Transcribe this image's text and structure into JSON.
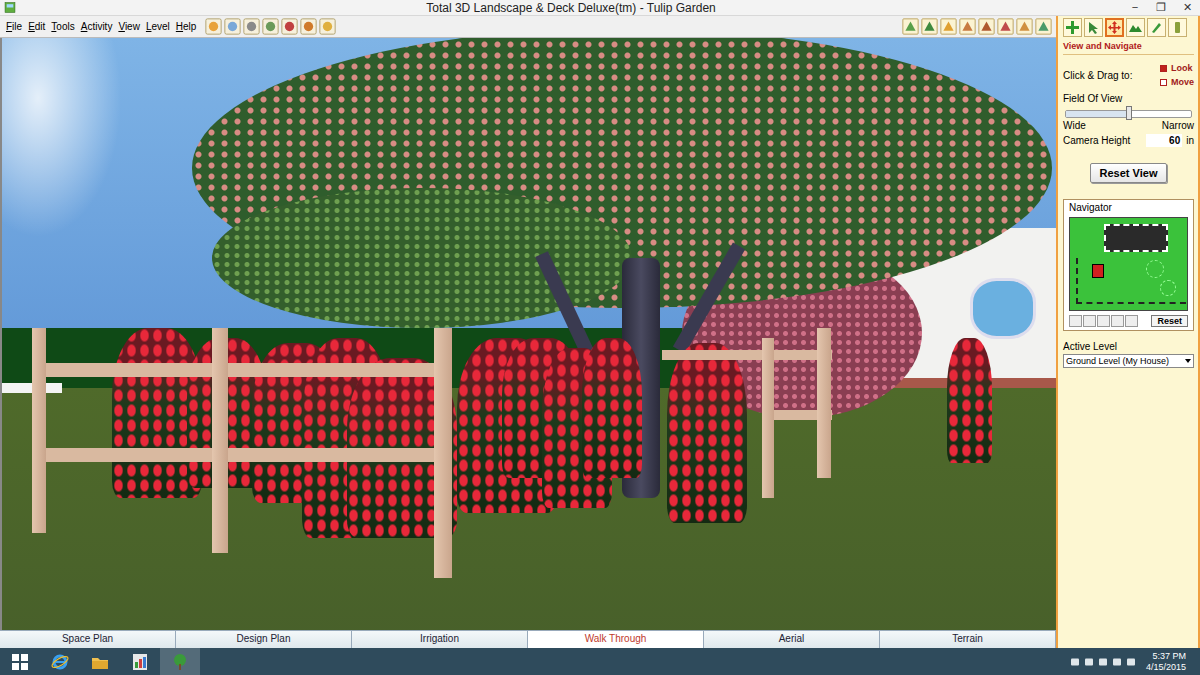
{
  "window": {
    "title": "Total 3D Landscape & Deck Deluxe(tm) - Tulip Garden",
    "controls": [
      "−",
      "❐",
      "✕"
    ]
  },
  "menu": [
    "File",
    "Edit",
    "Tools",
    "Activity",
    "View",
    "Level",
    "Help"
  ],
  "tool_palette": [
    {
      "selected": false
    },
    {
      "selected": false
    },
    {
      "selected": true
    },
    {
      "selected": false
    },
    {
      "selected": false
    },
    {
      "selected": false
    }
  ],
  "panel": {
    "title": "View and Navigate",
    "drag_label": "Click & Drag to:",
    "drag_options": [
      {
        "label": "Look",
        "selected": true
      },
      {
        "label": "Move",
        "selected": false
      }
    ],
    "fov_label": "Field Of View",
    "fov_level": 0.5,
    "fov_wide": "Wide",
    "fov_narrow": "Narrow",
    "camera_label": "Camera Height",
    "camera_value": "60",
    "camera_unit": "in",
    "reset_view": "Reset View",
    "navigator_label": "Navigator",
    "navigator_reset": "Reset",
    "active_level_label": "Active Level",
    "active_level": "Ground Level (My House)"
  },
  "tabs": [
    {
      "label": "Space Plan",
      "selected": false
    },
    {
      "label": "Design Plan",
      "selected": false
    },
    {
      "label": "Irrigation",
      "selected": false
    },
    {
      "label": "Walk Through",
      "selected": true
    },
    {
      "label": "Aerial",
      "selected": false
    },
    {
      "label": "Terrain",
      "selected": false
    }
  ],
  "taskbar": {
    "time": "5:37 PM",
    "date": "4/15/2015"
  }
}
